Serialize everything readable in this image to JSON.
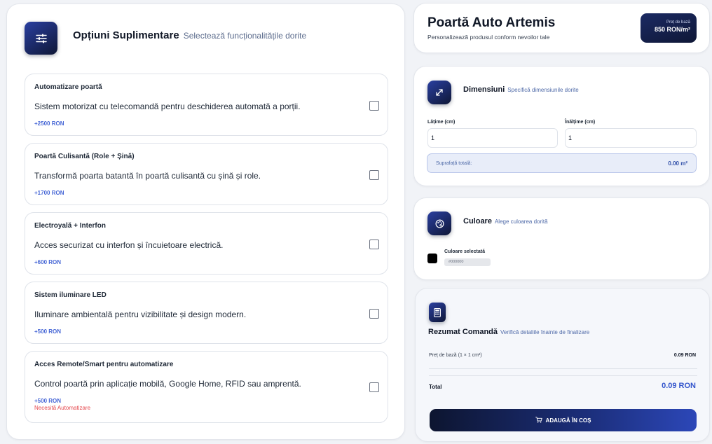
{
  "options_section": {
    "title": "Opțiuni Suplimentare",
    "subtitle": "Selectează funcționalitățile dorite",
    "icon": "sliders-icon",
    "items": [
      {
        "title": "Automatizare poartă",
        "description": "Sistem motorizat cu telecomandă pentru deschiderea automată a porții.",
        "price": "+2500 RON",
        "note": "",
        "checked": false
      },
      {
        "title": "Poartă Culisantă (Role + Șină)",
        "description": "Transformă poarta batantă în poartă culisantă cu șină și role.",
        "price": "+1700 RON",
        "note": "",
        "checked": false
      },
      {
        "title": "Electroyală + Interfon",
        "description": "Acces securizat cu interfon și încuietoare electrică.",
        "price": "+600 RON",
        "note": "",
        "checked": false
      },
      {
        "title": "Sistem iluminare LED",
        "description": "Iluminare ambientală pentru vizibilitate și design modern.",
        "price": "+500 RON",
        "note": "",
        "checked": false
      },
      {
        "title": "Acces Remote/Smart pentru automatizare",
        "description": "Control poartă prin aplicație mobilă, Google Home, RFID sau amprentă.",
        "price": "+500 RON",
        "note": "Necesită Automatizare",
        "checked": false
      }
    ]
  },
  "product": {
    "title": "Poartă Auto Artemis",
    "subtitle": "Personalizează produsul conform nevoilor tale",
    "base_price_label": "Preț de bază",
    "base_price_value": "850 RON/m²"
  },
  "dimensions": {
    "title": "Dimensiuni",
    "subtitle": "Specifică dimensiunile dorite",
    "icon": "expand-icon",
    "width_label": "Lățime (cm)",
    "width_value": "1",
    "height_label": "Înălțime (cm)",
    "height_value": "1",
    "area_label": "Suprafață totală:",
    "area_value": "0.00 m²"
  },
  "color": {
    "title": "Culoare",
    "subtitle": "Alege culoarea dorită",
    "icon": "palette-icon",
    "selected_label": "Culoare selectată",
    "selected_code": "#000000",
    "swatch_color": "#000000"
  },
  "summary": {
    "title": "Rezumat Comandă",
    "subtitle": "Verifică detaliile înainte de finalizare",
    "icon": "calculator-icon",
    "base_row_label": "Preț de bază (1 × 1 cm²)",
    "base_row_value": "0.09 RON",
    "total_label": "Total",
    "total_value": "0.09 RON",
    "cart_button_label": "ADAUGĂ ÎN COȘ",
    "cart_icon": "cart-icon"
  },
  "colors": {
    "accent": "#3355cc",
    "dark_navy": "#0f1736",
    "note_red": "#e5484d"
  }
}
